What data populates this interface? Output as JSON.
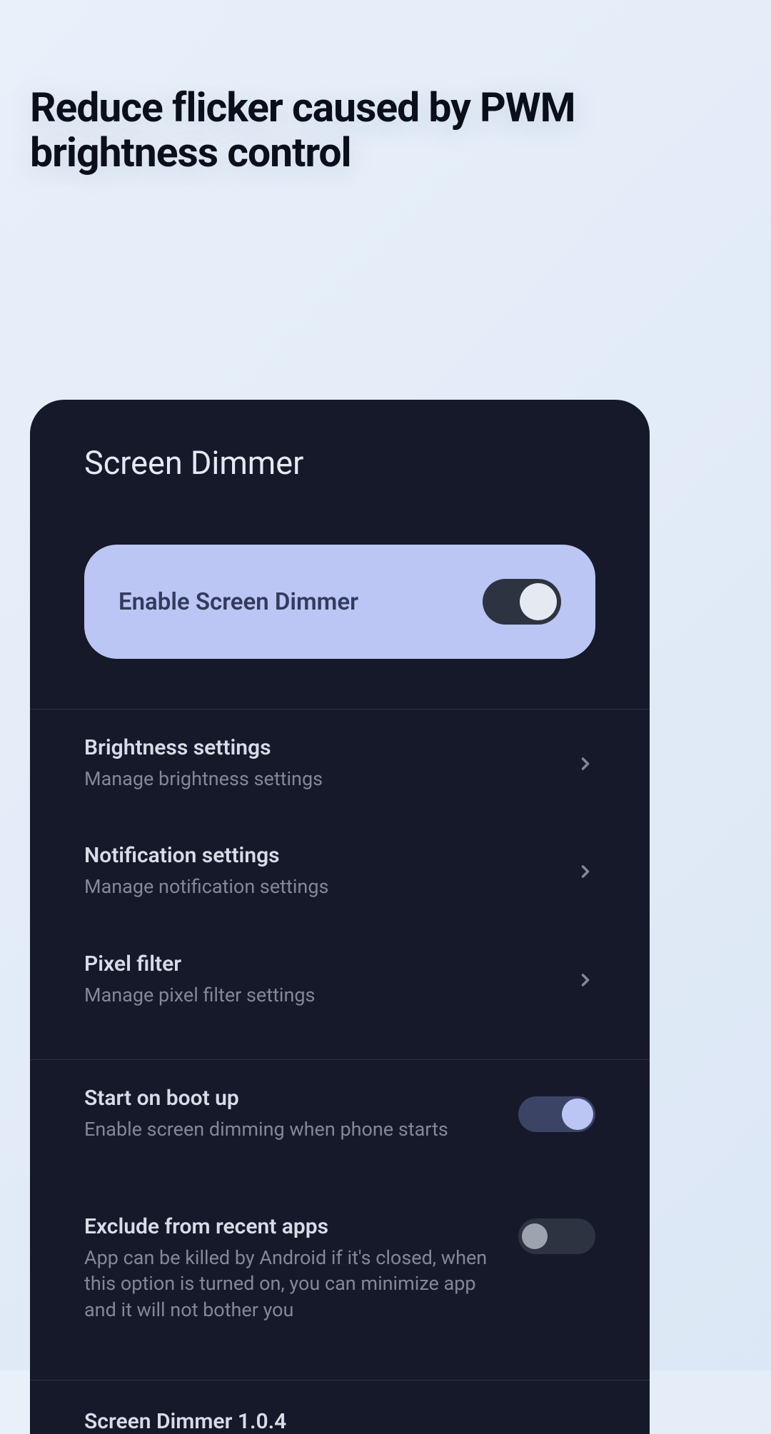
{
  "header": {
    "headline": "Reduce flicker caused by PWM brightness control"
  },
  "card": {
    "title": "Screen Dimmer",
    "enable": {
      "label": "Enable Screen Dimmer",
      "state": "on"
    },
    "navItems": [
      {
        "title": "Brightness settings",
        "subtitle": "Manage brightness settings"
      },
      {
        "title": "Notification settings",
        "subtitle": "Manage notification settings"
      },
      {
        "title": "Pixel filter",
        "subtitle": "Manage pixel filter settings"
      }
    ],
    "toggleItems": [
      {
        "title": "Start on boot up",
        "subtitle": "Enable screen dimming when phone starts",
        "state": "on"
      },
      {
        "title": "Exclude from recent apps",
        "subtitle": "App can be killed by Android if it's closed, when this option is turned on, you can minimize app and it will not bother you",
        "state": "off"
      }
    ],
    "version": "Screen Dimmer 1.0.4"
  }
}
